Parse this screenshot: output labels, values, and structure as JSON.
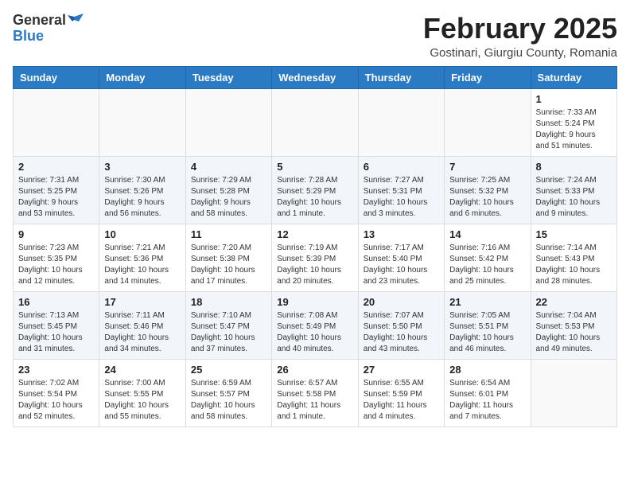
{
  "header": {
    "logo_general": "General",
    "logo_blue": "Blue",
    "month_year": "February 2025",
    "location": "Gostinari, Giurgiu County, Romania"
  },
  "weekdays": [
    "Sunday",
    "Monday",
    "Tuesday",
    "Wednesday",
    "Thursday",
    "Friday",
    "Saturday"
  ],
  "weeks": [
    [
      {
        "day": "",
        "info": ""
      },
      {
        "day": "",
        "info": ""
      },
      {
        "day": "",
        "info": ""
      },
      {
        "day": "",
        "info": ""
      },
      {
        "day": "",
        "info": ""
      },
      {
        "day": "",
        "info": ""
      },
      {
        "day": "1",
        "info": "Sunrise: 7:33 AM\nSunset: 5:24 PM\nDaylight: 9 hours\nand 51 minutes."
      }
    ],
    [
      {
        "day": "2",
        "info": "Sunrise: 7:31 AM\nSunset: 5:25 PM\nDaylight: 9 hours\nand 53 minutes."
      },
      {
        "day": "3",
        "info": "Sunrise: 7:30 AM\nSunset: 5:26 PM\nDaylight: 9 hours\nand 56 minutes."
      },
      {
        "day": "4",
        "info": "Sunrise: 7:29 AM\nSunset: 5:28 PM\nDaylight: 9 hours\nand 58 minutes."
      },
      {
        "day": "5",
        "info": "Sunrise: 7:28 AM\nSunset: 5:29 PM\nDaylight: 10 hours\nand 1 minute."
      },
      {
        "day": "6",
        "info": "Sunrise: 7:27 AM\nSunset: 5:31 PM\nDaylight: 10 hours\nand 3 minutes."
      },
      {
        "day": "7",
        "info": "Sunrise: 7:25 AM\nSunset: 5:32 PM\nDaylight: 10 hours\nand 6 minutes."
      },
      {
        "day": "8",
        "info": "Sunrise: 7:24 AM\nSunset: 5:33 PM\nDaylight: 10 hours\nand 9 minutes."
      }
    ],
    [
      {
        "day": "9",
        "info": "Sunrise: 7:23 AM\nSunset: 5:35 PM\nDaylight: 10 hours\nand 12 minutes."
      },
      {
        "day": "10",
        "info": "Sunrise: 7:21 AM\nSunset: 5:36 PM\nDaylight: 10 hours\nand 14 minutes."
      },
      {
        "day": "11",
        "info": "Sunrise: 7:20 AM\nSunset: 5:38 PM\nDaylight: 10 hours\nand 17 minutes."
      },
      {
        "day": "12",
        "info": "Sunrise: 7:19 AM\nSunset: 5:39 PM\nDaylight: 10 hours\nand 20 minutes."
      },
      {
        "day": "13",
        "info": "Sunrise: 7:17 AM\nSunset: 5:40 PM\nDaylight: 10 hours\nand 23 minutes."
      },
      {
        "day": "14",
        "info": "Sunrise: 7:16 AM\nSunset: 5:42 PM\nDaylight: 10 hours\nand 25 minutes."
      },
      {
        "day": "15",
        "info": "Sunrise: 7:14 AM\nSunset: 5:43 PM\nDaylight: 10 hours\nand 28 minutes."
      }
    ],
    [
      {
        "day": "16",
        "info": "Sunrise: 7:13 AM\nSunset: 5:45 PM\nDaylight: 10 hours\nand 31 minutes."
      },
      {
        "day": "17",
        "info": "Sunrise: 7:11 AM\nSunset: 5:46 PM\nDaylight: 10 hours\nand 34 minutes."
      },
      {
        "day": "18",
        "info": "Sunrise: 7:10 AM\nSunset: 5:47 PM\nDaylight: 10 hours\nand 37 minutes."
      },
      {
        "day": "19",
        "info": "Sunrise: 7:08 AM\nSunset: 5:49 PM\nDaylight: 10 hours\nand 40 minutes."
      },
      {
        "day": "20",
        "info": "Sunrise: 7:07 AM\nSunset: 5:50 PM\nDaylight: 10 hours\nand 43 minutes."
      },
      {
        "day": "21",
        "info": "Sunrise: 7:05 AM\nSunset: 5:51 PM\nDaylight: 10 hours\nand 46 minutes."
      },
      {
        "day": "22",
        "info": "Sunrise: 7:04 AM\nSunset: 5:53 PM\nDaylight: 10 hours\nand 49 minutes."
      }
    ],
    [
      {
        "day": "23",
        "info": "Sunrise: 7:02 AM\nSunset: 5:54 PM\nDaylight: 10 hours\nand 52 minutes."
      },
      {
        "day": "24",
        "info": "Sunrise: 7:00 AM\nSunset: 5:55 PM\nDaylight: 10 hours\nand 55 minutes."
      },
      {
        "day": "25",
        "info": "Sunrise: 6:59 AM\nSunset: 5:57 PM\nDaylight: 10 hours\nand 58 minutes."
      },
      {
        "day": "26",
        "info": "Sunrise: 6:57 AM\nSunset: 5:58 PM\nDaylight: 11 hours\nand 1 minute."
      },
      {
        "day": "27",
        "info": "Sunrise: 6:55 AM\nSunset: 5:59 PM\nDaylight: 11 hours\nand 4 minutes."
      },
      {
        "day": "28",
        "info": "Sunrise: 6:54 AM\nSunset: 6:01 PM\nDaylight: 11 hours\nand 7 minutes."
      },
      {
        "day": "",
        "info": ""
      }
    ]
  ]
}
